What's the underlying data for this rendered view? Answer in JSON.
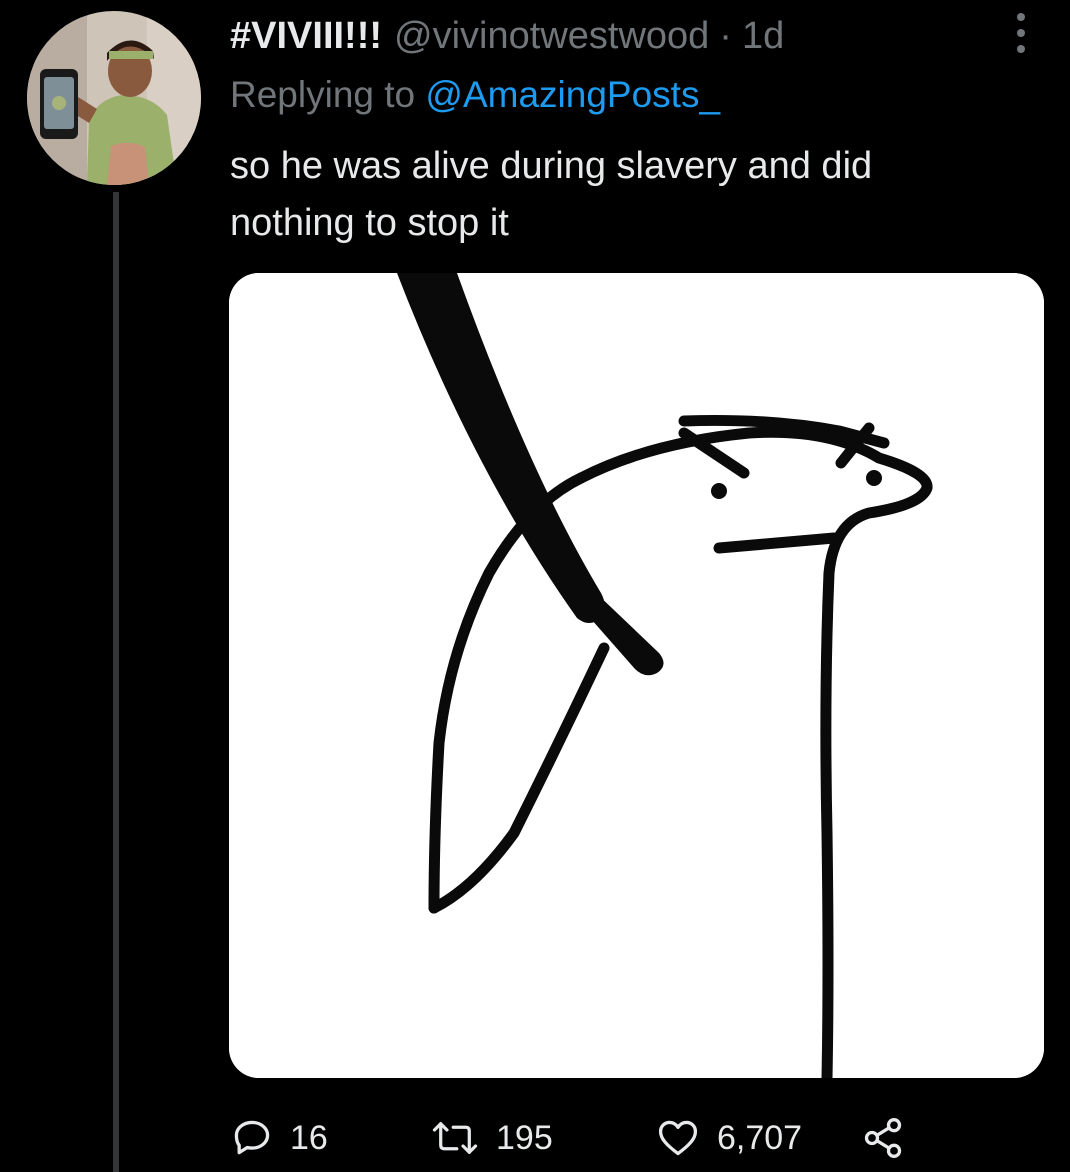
{
  "tweet": {
    "display_name": "#VIVIII!!!",
    "handle": "@vivinotwestwood",
    "separator": "·",
    "time": "1d",
    "replying_prefix": "Replying to",
    "replying_to": "@AmazingPosts_",
    "text_lines": [
      "so he was alive during slavery and did",
      "nothing to stop it"
    ],
    "media_description_icon": "meme-drawing",
    "avatar_icon": "profile-photo"
  },
  "actions": {
    "reply": {
      "icon": "reply-icon",
      "count": "16"
    },
    "retweet": {
      "icon": "retweet-icon",
      "count": "195"
    },
    "like": {
      "icon": "heart-icon",
      "count": "6,707"
    },
    "share": {
      "icon": "share-icon"
    }
  },
  "colors": {
    "background": "#000000",
    "text": "#e7e9ea",
    "secondary": "#71767b",
    "link": "#1d9bf0",
    "thread_line": "#333639"
  }
}
